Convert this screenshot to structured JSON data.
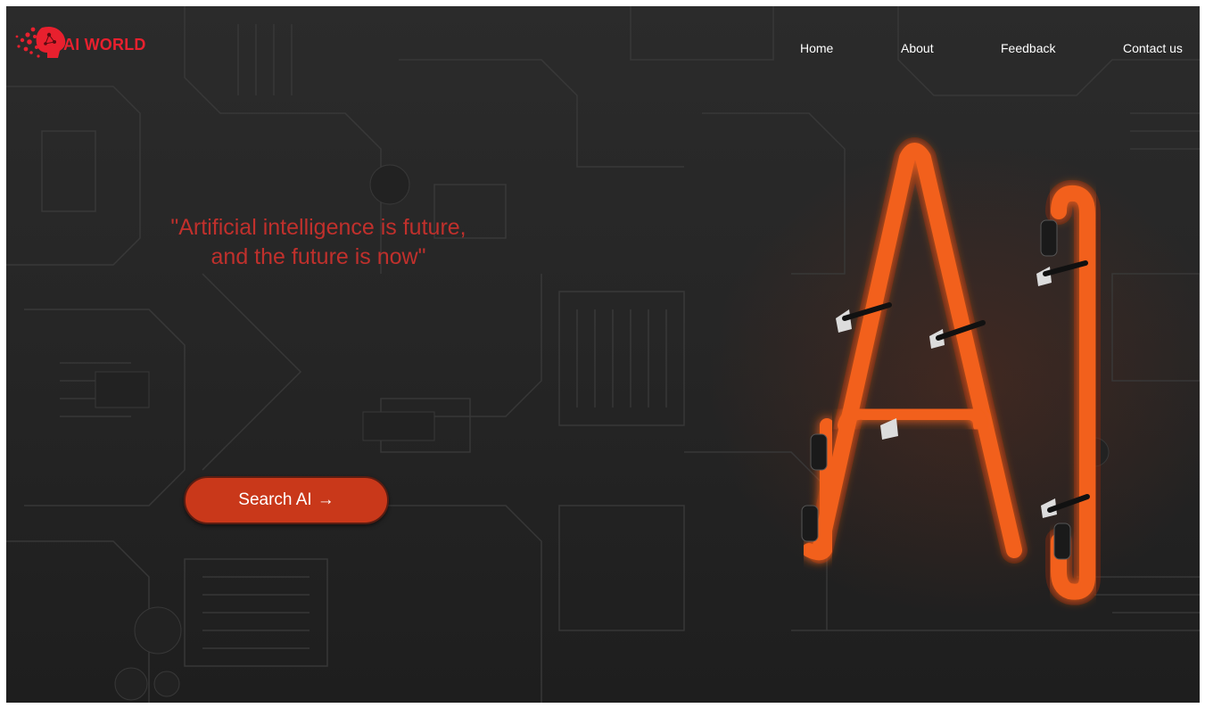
{
  "brand": {
    "name": "AI WORLD",
    "color": "#e8202e"
  },
  "nav": {
    "items": [
      {
        "label": "Home"
      },
      {
        "label": "About"
      },
      {
        "label": "Feedback"
      },
      {
        "label": "Contact us"
      }
    ]
  },
  "hero": {
    "quote_line1": "\"Artificial intelligence is future,",
    "quote_line2": "and the future is now\"",
    "quote_color": "#c0302c",
    "cta_label": "Search AI",
    "cta_icon": "arrow-right-icon",
    "cta_color": "#c9381a",
    "image": "neon-ai-sign"
  }
}
